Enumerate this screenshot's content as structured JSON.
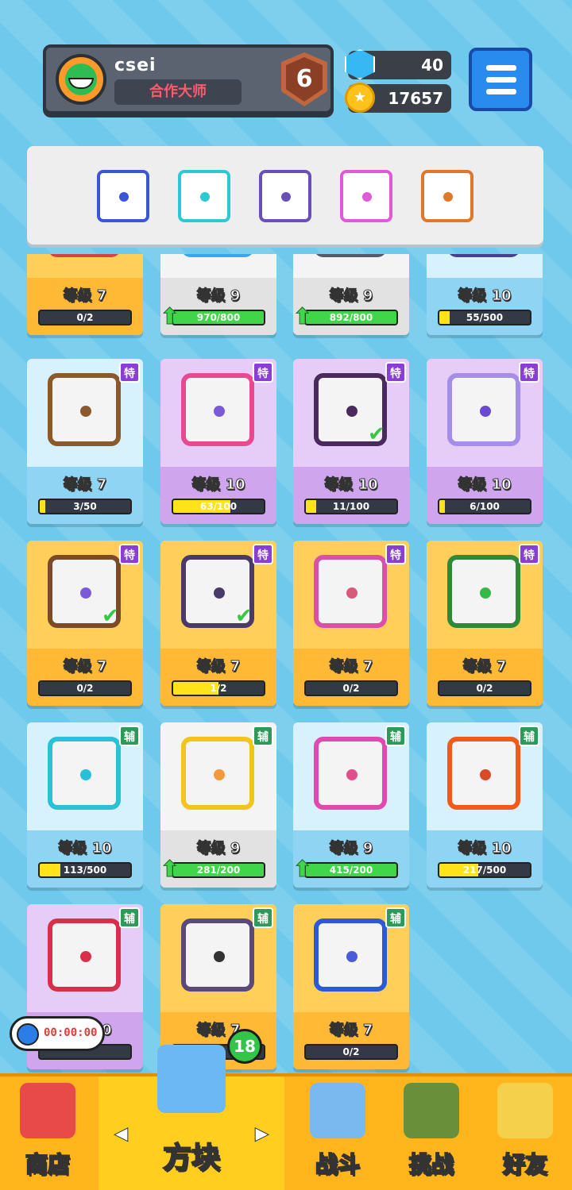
{
  "profile": {
    "username": "csei",
    "title": "合作大师",
    "rank": "6"
  },
  "currency": {
    "gems": "40",
    "coins": "17657"
  },
  "colors": {
    "bg": "#6fc9ec",
    "orange_card": "#ffc34a",
    "blue_card": "#9fdcf5",
    "purple_card": "#d9b8f0",
    "white_card": "#ececec"
  },
  "deck": [
    {
      "name": "gear-dice",
      "color": "#3b56d4"
    },
    {
      "name": "healing-dice",
      "color": "#2cc9d4"
    },
    {
      "name": "dragon-purple-dice",
      "color": "#6b4fb8"
    },
    {
      "name": "pink-arrow-dice",
      "color": "#e05ad8"
    },
    {
      "name": "dragon-infinity-dice",
      "color": "#e0782c"
    }
  ],
  "cards": [
    {
      "level": "等级 7",
      "progress": "0/2",
      "fill": 0,
      "tag": "",
      "theme": "orange",
      "border": "#d44444",
      "pip": "#d44444",
      "partial": true
    },
    {
      "level": "等级 9",
      "progress": "970/800",
      "fill": 1,
      "tag": "",
      "theme": "white",
      "border": "#39a7f0",
      "pip": "#39a7f0",
      "partial": true,
      "upgrade": true
    },
    {
      "level": "等级 9",
      "progress": "892/800",
      "fill": 1,
      "tag": "",
      "theme": "white",
      "border": "#555a66",
      "pip": "#555a66",
      "partial": true,
      "upgrade": true
    },
    {
      "level": "等级 10",
      "progress": "55/500",
      "fill": 0.11,
      "tag": "",
      "theme": "blue",
      "border": "#4a3f8f",
      "pip": "#4a3f8f",
      "partial": true
    },
    {
      "level": "等级 7",
      "progress": "3/50",
      "fill": 0.06,
      "tag": "特",
      "tag_color": "#8a3ed6",
      "theme": "blue",
      "border": "#8a5a2c",
      "pip": "#8a5a2c"
    },
    {
      "level": "等级 10",
      "progress": "63/100",
      "fill": 0.63,
      "tag": "特",
      "tag_color": "#8a3ed6",
      "theme": "purple",
      "border": "#e84a8f",
      "pip": "#7a5ad8"
    },
    {
      "level": "等级 10",
      "progress": "11/100",
      "fill": 0.11,
      "tag": "特",
      "tag_color": "#8a3ed6",
      "theme": "purple",
      "border": "#4a2a5c",
      "pip": "#4a2a5c",
      "check": true
    },
    {
      "level": "等级 10",
      "progress": "6/100",
      "fill": 0.06,
      "tag": "特",
      "tag_color": "#8a3ed6",
      "theme": "purple",
      "border": "#a58ee8",
      "pip": "#6a4ad0"
    },
    {
      "level": "等级 7",
      "progress": "0/2",
      "fill": 0,
      "tag": "特",
      "tag_color": "#8a3ed6",
      "theme": "orange",
      "border": "#7a4a2a",
      "pip": "#7a5ad8",
      "check": true
    },
    {
      "level": "等级 7",
      "progress": "1/2",
      "fill": 0.5,
      "tag": "特",
      "tag_color": "#8a3ed6",
      "theme": "orange",
      "border": "#4a3a6a",
      "pip": "#4a3a6a",
      "check": true
    },
    {
      "level": "等级 7",
      "progress": "0/2",
      "fill": 0,
      "tag": "特",
      "tag_color": "#8a3ed6",
      "theme": "orange",
      "border": "#d850a8",
      "pip": "#d85a7a"
    },
    {
      "level": "等级 7",
      "progress": "0/2",
      "fill": 0,
      "tag": "特",
      "tag_color": "#8a3ed6",
      "theme": "orange",
      "border": "#2e8a3a",
      "pip": "#38b848"
    },
    {
      "level": "等级 10",
      "progress": "113/500",
      "fill": 0.226,
      "tag": "辅",
      "tag_color": "#2e9a5a",
      "theme": "blue",
      "border": "#2ac0d6",
      "pip": "#2ac0d6"
    },
    {
      "level": "等级 9",
      "progress": "281/200",
      "fill": 1,
      "tag": "辅",
      "tag_color": "#2e9a5a",
      "theme": "white",
      "border": "#f2c51a",
      "pip": "#f29a3a",
      "upgrade": true
    },
    {
      "level": "等级 9",
      "progress": "415/200",
      "fill": 1,
      "tag": "辅",
      "tag_color": "#2e9a5a",
      "theme": "blue",
      "border": "#e04ab0",
      "pip": "#e0508a",
      "upgrade": true
    },
    {
      "level": "等级 10",
      "progress": "217/500",
      "fill": 0.434,
      "tag": "辅",
      "tag_color": "#2e9a5a",
      "theme": "blue",
      "border": "#f25a1a",
      "pip": "#d84a2a"
    },
    {
      "level": "等级 10",
      "progress": "",
      "fill": 0,
      "tag": "辅",
      "tag_color": "#2e9a5a",
      "theme": "purple",
      "border": "#d8304a",
      "pip": "#d8304a"
    },
    {
      "level": "等级 7",
      "progress": "",
      "fill": 0,
      "tag": "辅",
      "tag_color": "#2e9a5a",
      "theme": "orange",
      "border": "#5a4a7a",
      "pip": "#333333"
    },
    {
      "level": "等级 7",
      "progress": "0/2",
      "fill": 0,
      "tag": "辅",
      "tag_color": "#2e9a5a",
      "theme": "orange",
      "border": "#2a5ad8",
      "pip": "#4a5ad8"
    }
  ],
  "timer": "00:00:00",
  "cube_badge": "18",
  "nav": [
    {
      "label": "商店",
      "icon": "shop-icon"
    },
    {
      "label": "方块",
      "icon": "dice-box-icon",
      "active": true
    },
    {
      "label": "战斗",
      "icon": "battle-icon"
    },
    {
      "label": "挑战",
      "icon": "challenge-icon"
    },
    {
      "label": "好友",
      "icon": "friends-icon"
    }
  ]
}
